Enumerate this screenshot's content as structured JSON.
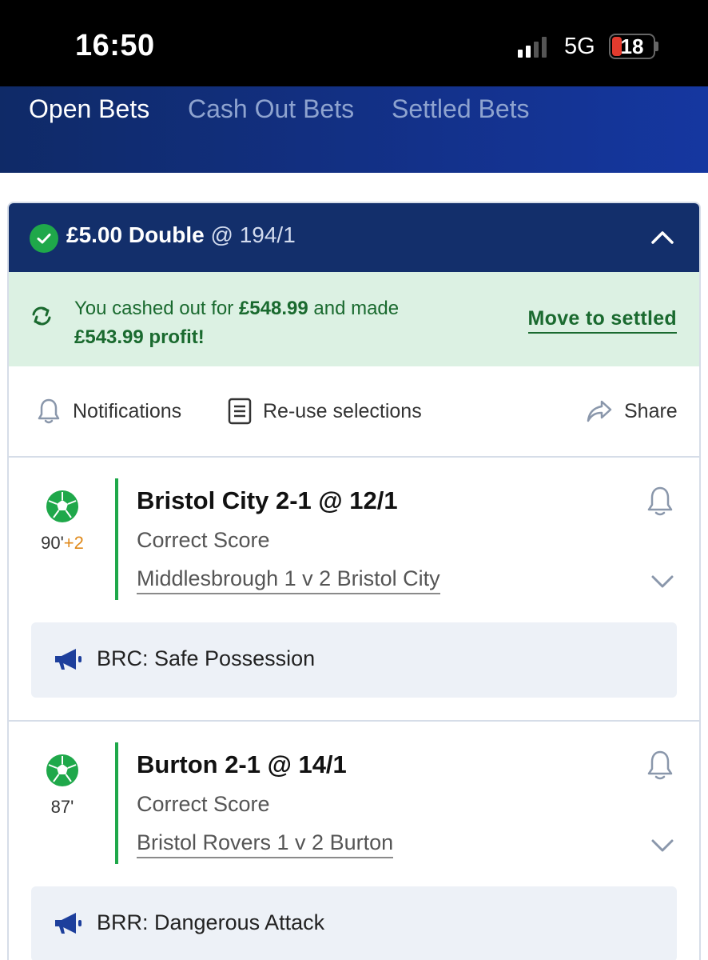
{
  "status_bar": {
    "time": "16:50",
    "network": "5G",
    "battery": "18"
  },
  "tabs": [
    {
      "label": "Open Bets",
      "active": true
    },
    {
      "label": "Cash Out Bets",
      "active": false
    },
    {
      "label": "Settled Bets",
      "active": false
    }
  ],
  "bet": {
    "stake_type": "£5.00 Double",
    "odds": "@ 194/1",
    "cashout": {
      "prefix": "You cashed out for ",
      "amount": "£548.99",
      "middle": " and made",
      "profit": "£543.99 profit!",
      "move_label": "Move to settled"
    },
    "actions": {
      "notifications": "Notifications",
      "reuse": "Re-use selections",
      "share": "Share"
    },
    "selections": [
      {
        "minute": "90'",
        "added": "+2",
        "title": "Bristol City 2-1 @ 12/1",
        "market": "Correct Score",
        "event": "Middlesbrough 1 v 2 Bristol City",
        "live_update": "BRC: Safe Possession"
      },
      {
        "minute": "87'",
        "added": "",
        "title": "Burton 2-1 @ 14/1",
        "market": "Correct Score",
        "event": "Bristol Rovers 1 v 2 Burton",
        "live_update": "BRR: Dangerous Attack"
      }
    ]
  },
  "colors": {
    "header_navy": "#132f6b",
    "cashout_bg": "#dcf1e3",
    "cashout_text": "#1a6a2f",
    "live_green": "#1fa84a",
    "added_time": "#e08a1c"
  }
}
